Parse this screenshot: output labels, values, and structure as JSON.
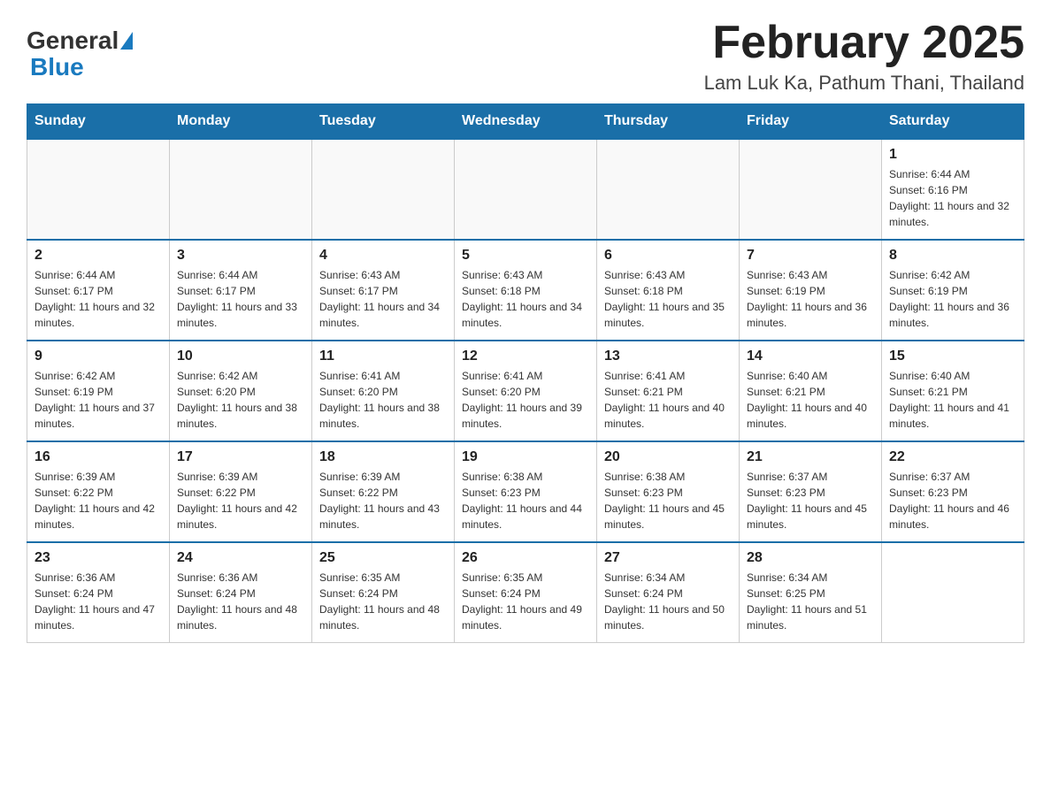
{
  "header": {
    "logo": {
      "general": "General",
      "blue": "Blue"
    },
    "title": "February 2025",
    "subtitle": "Lam Luk Ka, Pathum Thani, Thailand"
  },
  "calendar": {
    "days_of_week": [
      "Sunday",
      "Monday",
      "Tuesday",
      "Wednesday",
      "Thursday",
      "Friday",
      "Saturday"
    ],
    "weeks": [
      [
        {
          "day": "",
          "sunrise": "",
          "sunset": "",
          "daylight": ""
        },
        {
          "day": "",
          "sunrise": "",
          "sunset": "",
          "daylight": ""
        },
        {
          "day": "",
          "sunrise": "",
          "sunset": "",
          "daylight": ""
        },
        {
          "day": "",
          "sunrise": "",
          "sunset": "",
          "daylight": ""
        },
        {
          "day": "",
          "sunrise": "",
          "sunset": "",
          "daylight": ""
        },
        {
          "day": "",
          "sunrise": "",
          "sunset": "",
          "daylight": ""
        },
        {
          "day": "1",
          "sunrise": "Sunrise: 6:44 AM",
          "sunset": "Sunset: 6:16 PM",
          "daylight": "Daylight: 11 hours and 32 minutes."
        }
      ],
      [
        {
          "day": "2",
          "sunrise": "Sunrise: 6:44 AM",
          "sunset": "Sunset: 6:17 PM",
          "daylight": "Daylight: 11 hours and 32 minutes."
        },
        {
          "day": "3",
          "sunrise": "Sunrise: 6:44 AM",
          "sunset": "Sunset: 6:17 PM",
          "daylight": "Daylight: 11 hours and 33 minutes."
        },
        {
          "day": "4",
          "sunrise": "Sunrise: 6:43 AM",
          "sunset": "Sunset: 6:17 PM",
          "daylight": "Daylight: 11 hours and 34 minutes."
        },
        {
          "day": "5",
          "sunrise": "Sunrise: 6:43 AM",
          "sunset": "Sunset: 6:18 PM",
          "daylight": "Daylight: 11 hours and 34 minutes."
        },
        {
          "day": "6",
          "sunrise": "Sunrise: 6:43 AM",
          "sunset": "Sunset: 6:18 PM",
          "daylight": "Daylight: 11 hours and 35 minutes."
        },
        {
          "day": "7",
          "sunrise": "Sunrise: 6:43 AM",
          "sunset": "Sunset: 6:19 PM",
          "daylight": "Daylight: 11 hours and 36 minutes."
        },
        {
          "day": "8",
          "sunrise": "Sunrise: 6:42 AM",
          "sunset": "Sunset: 6:19 PM",
          "daylight": "Daylight: 11 hours and 36 minutes."
        }
      ],
      [
        {
          "day": "9",
          "sunrise": "Sunrise: 6:42 AM",
          "sunset": "Sunset: 6:19 PM",
          "daylight": "Daylight: 11 hours and 37 minutes."
        },
        {
          "day": "10",
          "sunrise": "Sunrise: 6:42 AM",
          "sunset": "Sunset: 6:20 PM",
          "daylight": "Daylight: 11 hours and 38 minutes."
        },
        {
          "day": "11",
          "sunrise": "Sunrise: 6:41 AM",
          "sunset": "Sunset: 6:20 PM",
          "daylight": "Daylight: 11 hours and 38 minutes."
        },
        {
          "day": "12",
          "sunrise": "Sunrise: 6:41 AM",
          "sunset": "Sunset: 6:20 PM",
          "daylight": "Daylight: 11 hours and 39 minutes."
        },
        {
          "day": "13",
          "sunrise": "Sunrise: 6:41 AM",
          "sunset": "Sunset: 6:21 PM",
          "daylight": "Daylight: 11 hours and 40 minutes."
        },
        {
          "day": "14",
          "sunrise": "Sunrise: 6:40 AM",
          "sunset": "Sunset: 6:21 PM",
          "daylight": "Daylight: 11 hours and 40 minutes."
        },
        {
          "day": "15",
          "sunrise": "Sunrise: 6:40 AM",
          "sunset": "Sunset: 6:21 PM",
          "daylight": "Daylight: 11 hours and 41 minutes."
        }
      ],
      [
        {
          "day": "16",
          "sunrise": "Sunrise: 6:39 AM",
          "sunset": "Sunset: 6:22 PM",
          "daylight": "Daylight: 11 hours and 42 minutes."
        },
        {
          "day": "17",
          "sunrise": "Sunrise: 6:39 AM",
          "sunset": "Sunset: 6:22 PM",
          "daylight": "Daylight: 11 hours and 42 minutes."
        },
        {
          "day": "18",
          "sunrise": "Sunrise: 6:39 AM",
          "sunset": "Sunset: 6:22 PM",
          "daylight": "Daylight: 11 hours and 43 minutes."
        },
        {
          "day": "19",
          "sunrise": "Sunrise: 6:38 AM",
          "sunset": "Sunset: 6:23 PM",
          "daylight": "Daylight: 11 hours and 44 minutes."
        },
        {
          "day": "20",
          "sunrise": "Sunrise: 6:38 AM",
          "sunset": "Sunset: 6:23 PM",
          "daylight": "Daylight: 11 hours and 45 minutes."
        },
        {
          "day": "21",
          "sunrise": "Sunrise: 6:37 AM",
          "sunset": "Sunset: 6:23 PM",
          "daylight": "Daylight: 11 hours and 45 minutes."
        },
        {
          "day": "22",
          "sunrise": "Sunrise: 6:37 AM",
          "sunset": "Sunset: 6:23 PM",
          "daylight": "Daylight: 11 hours and 46 minutes."
        }
      ],
      [
        {
          "day": "23",
          "sunrise": "Sunrise: 6:36 AM",
          "sunset": "Sunset: 6:24 PM",
          "daylight": "Daylight: 11 hours and 47 minutes."
        },
        {
          "day": "24",
          "sunrise": "Sunrise: 6:36 AM",
          "sunset": "Sunset: 6:24 PM",
          "daylight": "Daylight: 11 hours and 48 minutes."
        },
        {
          "day": "25",
          "sunrise": "Sunrise: 6:35 AM",
          "sunset": "Sunset: 6:24 PM",
          "daylight": "Daylight: 11 hours and 48 minutes."
        },
        {
          "day": "26",
          "sunrise": "Sunrise: 6:35 AM",
          "sunset": "Sunset: 6:24 PM",
          "daylight": "Daylight: 11 hours and 49 minutes."
        },
        {
          "day": "27",
          "sunrise": "Sunrise: 6:34 AM",
          "sunset": "Sunset: 6:24 PM",
          "daylight": "Daylight: 11 hours and 50 minutes."
        },
        {
          "day": "28",
          "sunrise": "Sunrise: 6:34 AM",
          "sunset": "Sunset: 6:25 PM",
          "daylight": "Daylight: 11 hours and 51 minutes."
        },
        {
          "day": "",
          "sunrise": "",
          "sunset": "",
          "daylight": ""
        }
      ]
    ]
  }
}
